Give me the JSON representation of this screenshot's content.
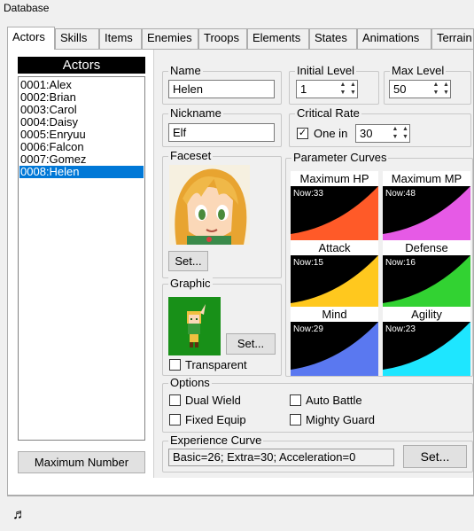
{
  "window": {
    "title": "Database"
  },
  "tabs": [
    "Actors",
    "Skills",
    "Items",
    "Enemies",
    "Troops",
    "Elements",
    "States",
    "Animations",
    "Terrain"
  ],
  "actors": {
    "header": "Actors",
    "items": [
      "0001:Alex",
      "0002:Brian",
      "0003:Carol",
      "0004:Daisy",
      "0005:Enryuu",
      "0006:Falcon",
      "0007:Gomez",
      "0008:Helen"
    ],
    "selected_index": 7,
    "max_button": "Maximum Number"
  },
  "name": {
    "label": "Name",
    "value": "Helen"
  },
  "initial_level": {
    "label": "Initial Level",
    "value": "1"
  },
  "max_level": {
    "label": "Max Level",
    "value": "50"
  },
  "nickname": {
    "label": "Nickname",
    "value": "Elf"
  },
  "critical": {
    "label": "Critical Rate",
    "checkbox_label": "One in",
    "value": "30",
    "checked": true
  },
  "faceset": {
    "label": "Faceset",
    "button": "Set..."
  },
  "graphic": {
    "label": "Graphic",
    "button": "Set...",
    "transparent_label": "Transparent"
  },
  "param_curves": {
    "label": "Parameter Curves",
    "items": [
      {
        "label": "Maximum HP",
        "now": "Now:33",
        "color": "#ff5a28"
      },
      {
        "label": "Maximum MP",
        "now": "Now:48",
        "color": "#e65ae6"
      },
      {
        "label": "Attack",
        "now": "Now:15",
        "color": "#ffc81e"
      },
      {
        "label": "Defense",
        "now": "Now:16",
        "color": "#32d232"
      },
      {
        "label": "Mind",
        "now": "Now:29",
        "color": "#5a78f0"
      },
      {
        "label": "Agility",
        "now": "Now:23",
        "color": "#1ee6ff"
      }
    ]
  },
  "options": {
    "label": "Options",
    "dual": "Dual Wield",
    "auto": "Auto Battle",
    "fixed": "Fixed Equip",
    "mighty": "Mighty Guard"
  },
  "exp": {
    "label": "Experience Curve",
    "value": "Basic=26; Extra=30; Acceleration=0",
    "button": "Set..."
  },
  "colors": {
    "selection": "#0078d7"
  }
}
